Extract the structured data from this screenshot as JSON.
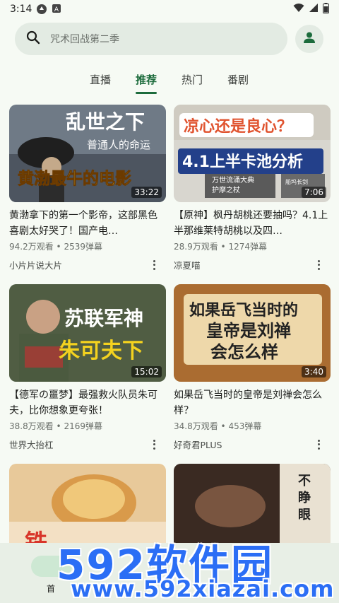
{
  "status": {
    "time": "3:14"
  },
  "search": {
    "placeholder": "咒术回战第二季"
  },
  "tabs": [
    {
      "label": "直播",
      "active": false
    },
    {
      "label": "推荐",
      "active": true
    },
    {
      "label": "热门",
      "active": false
    },
    {
      "label": "番剧",
      "active": false
    }
  ],
  "videos": [
    {
      "title": "黄渤拿下的第一个影帝，这部黑色喜剧太好哭了！国产电…",
      "views": "94.2万观看",
      "danmaku": "2539弹幕",
      "author": "小片片说大片",
      "duration": "33:22",
      "thumb_text": [
        "乱世之下",
        "普通人的命运",
        "黄渤最牛的电影"
      ]
    },
    {
      "title": "【原神】枫丹胡桃还要抽吗？4.1上半那维莱特胡桃以及四…",
      "views": "28.9万观看",
      "danmaku": "1274弹幕",
      "author": "凉夏喵",
      "duration": "7:06",
      "thumb_text": [
        "凉心还是良心？",
        "4.1上半卡池分析",
        "万世流涌大典",
        "护摩之杖",
        "船坞长剑"
      ]
    },
    {
      "title": "【德军の噩梦】最强救火队员朱可夫，比你想象更夸张！",
      "views": "38.8万观看",
      "danmaku": "2169弹幕",
      "author": "世界大抬杠",
      "duration": "15:02",
      "thumb_text": [
        "苏联军神",
        "朱可夫下"
      ]
    },
    {
      "title": "如果岳飞当时的皇帝是刘禅会怎么样？",
      "views": "34.8万观看",
      "danmaku": "453弹幕",
      "author": "好奇君PLUS",
      "duration": "3:40",
      "thumb_text": [
        "如果岳飞当时的",
        "皇帝是刘禅",
        "会怎么样"
      ]
    },
    {
      "title": "",
      "views": "",
      "danmaku": "",
      "author": "",
      "duration": "",
      "thumb_text": [
        "铁"
      ]
    },
    {
      "title": "",
      "views": "",
      "danmaku": "",
      "author": "",
      "duration": "",
      "thumb_text": [
        "不",
        "睁",
        "眼"
      ]
    }
  ],
  "meta_separator": " • ",
  "bottom_nav": {
    "home_label": "首"
  },
  "watermark": {
    "line1": "592软件园",
    "line2": "www.592xiazai.com"
  },
  "colors": {
    "accent": "#1c6b3c",
    "watermark": "#2b6ef5"
  }
}
